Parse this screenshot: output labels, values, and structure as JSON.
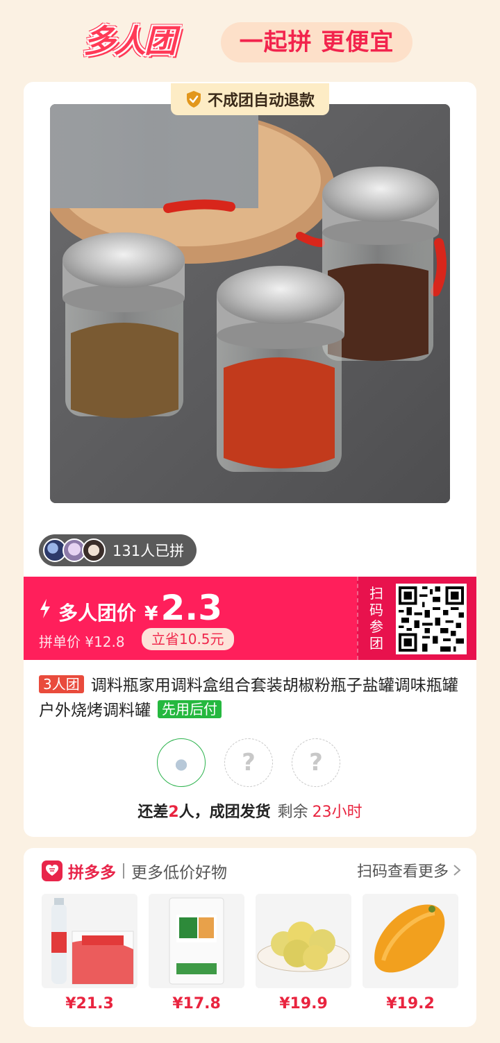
{
  "header": {
    "logo_text": "多人团",
    "slogan": "一起拼 更便宜"
  },
  "badge": {
    "refund_text": "不成团自动退款",
    "icon": "shield-check-icon"
  },
  "product": {
    "image_alt": "spice-jars-image",
    "joined_count_text": "131人已拼",
    "team_tag": "3人团",
    "title": "调料瓶家用调料盒组合套装胡椒粉瓶子盐罐调味瓶罐户外烧烤调料罐",
    "pay_tag": "先用后付"
  },
  "price": {
    "label": "多人团价",
    "currency": "¥",
    "value": "2.3",
    "single_price_text": "拼单价 ¥12.8",
    "save_text": "立省10.5元",
    "scan_text": "扫码参团"
  },
  "members": {
    "filled_count": 1,
    "empty_placeholder": "?",
    "status_prefix": "还差",
    "status_number": "2",
    "status_suffix": "人，成团发货",
    "remaining_label": "剩余",
    "remaining_time": "23小时"
  },
  "recommend": {
    "brand": "拼多多",
    "subtitle": "更多低价好物",
    "more_link": "扫码查看更多",
    "items": [
      {
        "price": "¥21.3",
        "icon": "water-bottles-image"
      },
      {
        "price": "¥17.8",
        "icon": "flour-bag-image"
      },
      {
        "price": "¥19.9",
        "icon": "lemons-image"
      },
      {
        "price": "¥19.2",
        "icon": "mango-image"
      }
    ]
  },
  "colors": {
    "accent_red": "#ff1f5b",
    "background": "#fbf1e3",
    "green": "#25b83f"
  }
}
